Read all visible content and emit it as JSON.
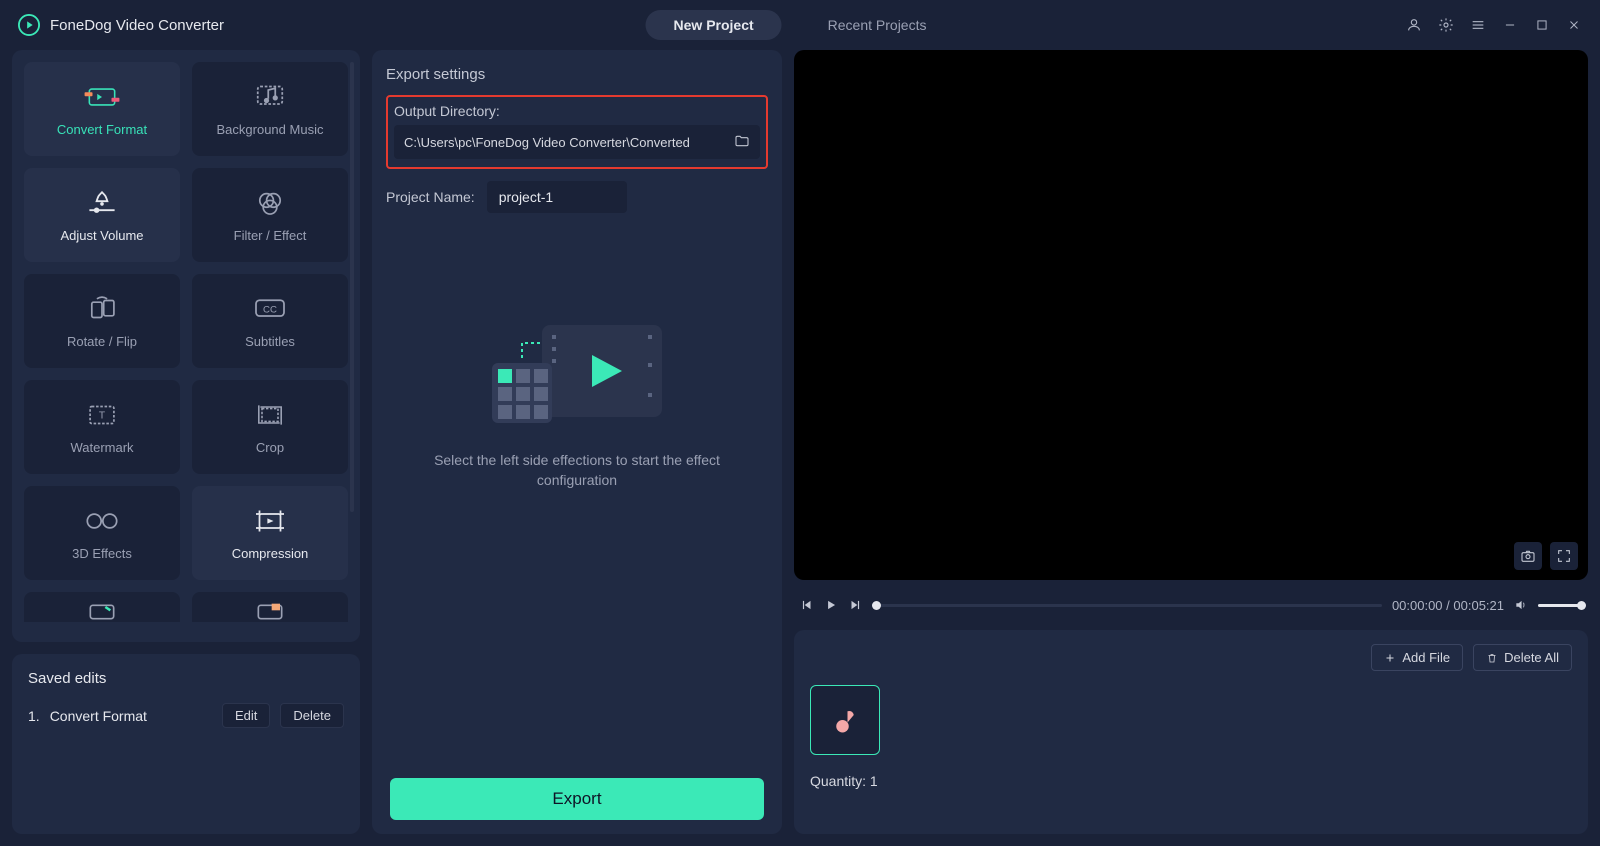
{
  "app_title": "FoneDog Video Converter",
  "tabs": {
    "new_project": "New Project",
    "recent_projects": "Recent Projects"
  },
  "effects": [
    {
      "label": "Convert Format",
      "state": "active"
    },
    {
      "label": "Background Music",
      "state": "default"
    },
    {
      "label": "Adjust Volume",
      "state": "light"
    },
    {
      "label": "Filter / Effect",
      "state": "default"
    },
    {
      "label": "Rotate / Flip",
      "state": "default"
    },
    {
      "label": "Subtitles",
      "state": "default"
    },
    {
      "label": "Watermark",
      "state": "default"
    },
    {
      "label": "Crop",
      "state": "default"
    },
    {
      "label": "3D Effects",
      "state": "default"
    },
    {
      "label": "Compression",
      "state": "light"
    }
  ],
  "saved": {
    "title": "Saved edits",
    "item_num": "1.",
    "item_name": "Convert Format",
    "edit_btn": "Edit",
    "delete_btn": "Delete"
  },
  "export": {
    "section": "Export settings",
    "out_dir_label": "Output Directory:",
    "out_dir_value": "C:\\Users\\pc\\FoneDog Video Converter\\Converted",
    "proj_label": "Project Name:",
    "proj_value": "project-1",
    "hint": "Select the left side effections to start the effect configuration",
    "button": "Export"
  },
  "player": {
    "time_current": "00:00:00",
    "time_total": "00:05:21"
  },
  "files": {
    "add_btn": "Add File",
    "delete_btn": "Delete All",
    "quantity_label": "Quantity:",
    "quantity_value": "1"
  }
}
